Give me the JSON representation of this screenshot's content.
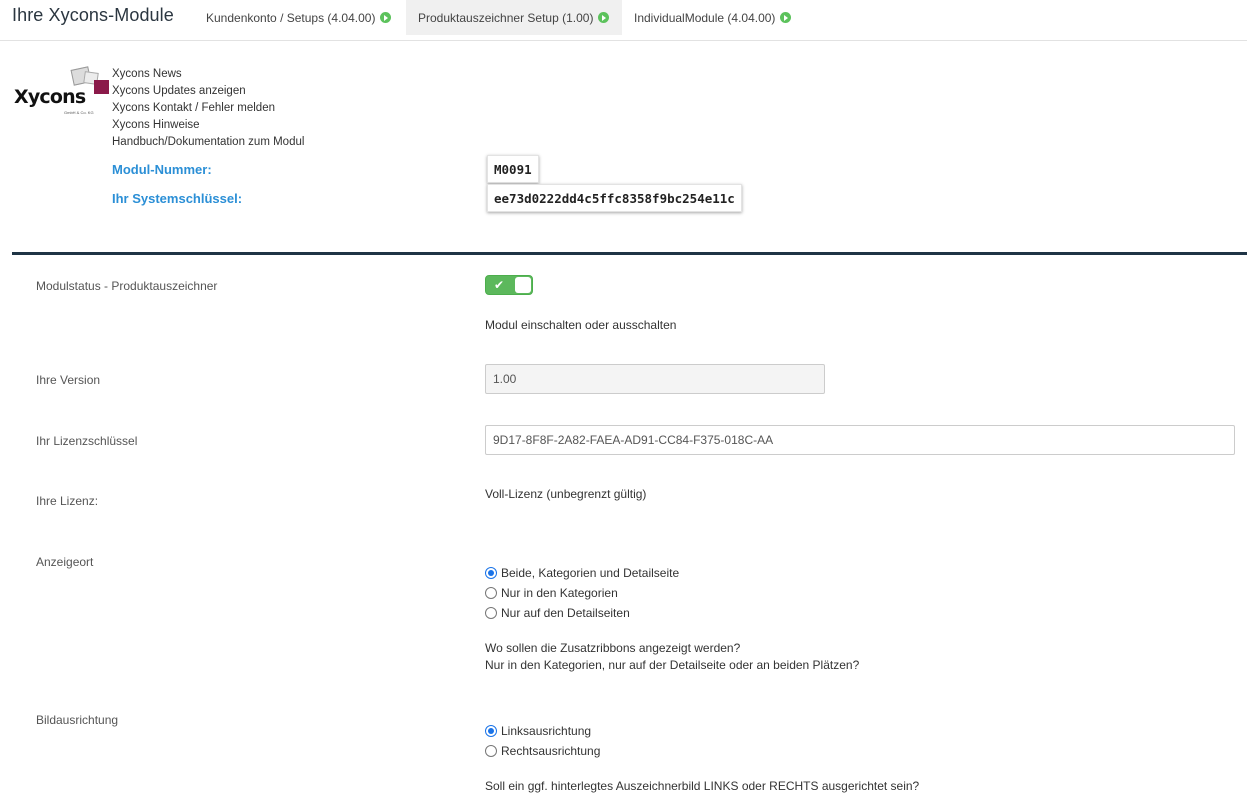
{
  "header": {
    "title": "Ihre Xycons-Module",
    "tabs": [
      {
        "label": "Kundenkonto / Setups (4.04.00)"
      },
      {
        "label": "Produktauszeichner Setup (1.00)"
      },
      {
        "label": "IndividualModule (4.04.00)"
      }
    ]
  },
  "logo": {
    "word": "Xycons",
    "sub": "GmbH & Co. KG"
  },
  "links": [
    "Xycons News",
    "Xycons Updates anzeigen",
    "Xycons Kontakt / Fehler melden",
    "Xycons Hinweise",
    "Handbuch/Dokumentation zum Modul"
  ],
  "module": {
    "number_label": "Modul-Nummer:",
    "number_value": "M0091",
    "key_label": "Ihr Systemschlüssel:",
    "key_value": "ee73d0222dd4c5ffc8358f9bc254e11c"
  },
  "form": {
    "status_label": "Modulstatus - Produktauszeichner",
    "status_enabled": true,
    "status_check": "✔",
    "status_help": "Modul einschalten oder ausschalten",
    "version_label": "Ihre Version",
    "version_value": "1.00",
    "license_key_label": "Ihr Lizenzschlüssel",
    "license_key_value": "9D17-8F8F-2A82-FAEA-AD91-CC84-F375-018C-AA",
    "license_label": "Ihre Lizenz:",
    "license_value": "Voll-Lizenz (unbegrenzt gültig)",
    "display_label": "Anzeigeort",
    "display_options": [
      "Beide, Kategorien und Detailseite",
      "Nur in den Kategorien",
      "Nur auf den Detailseiten"
    ],
    "display_selected": 0,
    "display_help_1": "Wo sollen die Zusatzribbons angezeigt werden?",
    "display_help_2": "Nur in den Kategorien, nur auf der Detailseite oder an beiden Plätzen?",
    "align_label": "Bildausrichtung",
    "align_options": [
      "Linksausrichtung",
      "Rechtsausrichtung"
    ],
    "align_selected": 0,
    "align_help": "Soll ein ggf. hinterlegtes Auszeichnerbild LINKS oder RECHTS ausgerichtet sein?"
  }
}
